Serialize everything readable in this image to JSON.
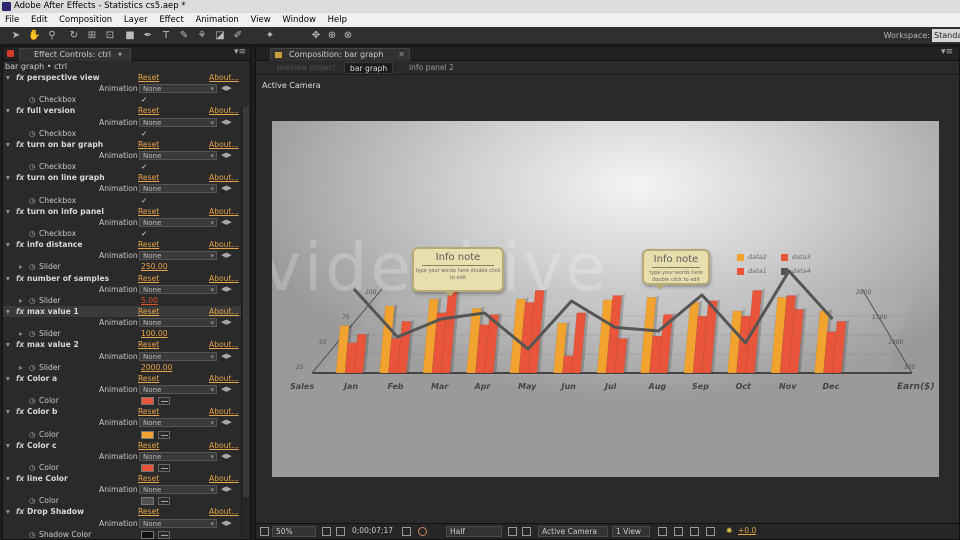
{
  "window": {
    "title": "Adobe After Effects - Statistics cs5.aep *"
  },
  "menu": [
    "File",
    "Edit",
    "Composition",
    "Layer",
    "Effect",
    "Animation",
    "View",
    "Window",
    "Help"
  ],
  "toolbar": {
    "workspace_label": "Workspace:",
    "workspace_value": "Standard"
  },
  "effect_controls": {
    "tab_label": "Effect Controls: ctrl",
    "layer_path": "bar graph • ctrl",
    "reset_label": "Reset",
    "about_label": "About...",
    "presets_label": "Animation Presets:",
    "presets_value": "None",
    "effects": [
      {
        "name": "perspective view",
        "prop": "Checkbox",
        "kind": "checkbox",
        "value": "✓"
      },
      {
        "name": "full version",
        "prop": "Checkbox",
        "kind": "checkbox",
        "value": "✓"
      },
      {
        "name": "turn on  bar graph",
        "prop": "Checkbox",
        "kind": "checkbox",
        "value": "✓"
      },
      {
        "name": "turn on  line graph",
        "prop": "Checkbox",
        "kind": "checkbox",
        "value": "✓"
      },
      {
        "name": "turn on  info panel",
        "prop": "Checkbox",
        "kind": "checkbox",
        "value": "✓"
      },
      {
        "name": "info distance",
        "prop": "Slider",
        "kind": "slider",
        "value": "250.00"
      },
      {
        "name": "number of samples",
        "prop": "Slider",
        "kind": "slider",
        "value": "5.00",
        "red": true
      },
      {
        "name": "max value 1",
        "prop": "Slider",
        "kind": "slider",
        "value": "100.00",
        "selected": true
      },
      {
        "name": "max value 2",
        "prop": "Slider",
        "kind": "slider",
        "value": "2000.00"
      },
      {
        "name": "Color a",
        "prop": "Color",
        "kind": "color",
        "value": "#e8553a"
      },
      {
        "name": "Color b",
        "prop": "Color",
        "kind": "color",
        "value": "#f2a22e"
      },
      {
        "name": "Color c",
        "prop": "Color",
        "kind": "color",
        "value": "#e8553a"
      },
      {
        "name": "line Color",
        "prop": "Color",
        "kind": "color",
        "value": "#505050"
      },
      {
        "name": "Drop Shadow",
        "prop": "Shadow Color",
        "kind": "color",
        "value": "#111111"
      }
    ]
  },
  "composition": {
    "tab_label": "Composition: bar graph",
    "breadcrumbs": [
      "preview project",
      "bar graph",
      "info panel  2"
    ],
    "camera_label": "Active Camera",
    "watermark": "videohive"
  },
  "chart_data": {
    "type": "bar",
    "categories": [
      "Jan",
      "Feb",
      "Mar",
      "Apr",
      "May",
      "Jun",
      "Jul",
      "Aug",
      "Sep",
      "Oct",
      "Nov",
      "Dec"
    ],
    "xlabel": "Sales",
    "x2label": "Earn($)",
    "left_axis_ticks": [
      "25",
      "50",
      "75",
      "100"
    ],
    "right_axis_ticks": [
      "500",
      "1000",
      "1500",
      "2000"
    ],
    "ylim": [
      0,
      100
    ],
    "series": [
      {
        "name": "data1",
        "color": "#e8553a",
        "values": [
          35,
          40,
          70,
          56,
          82,
          20,
          90,
          43,
          66,
          66,
          90,
          48
        ]
      },
      {
        "name": "data2",
        "color": "#f2a22e",
        "values": [
          55,
          78,
          86,
          75,
          86,
          58,
          85,
          88,
          82,
          72,
          88,
          72
        ]
      },
      {
        "name": "data3",
        "color": "#e8553a",
        "values": [
          45,
          60,
          95,
          68,
          96,
          70,
          40,
          68,
          84,
          96,
          74,
          60
        ]
      },
      {
        "name": "data4",
        "color": "#555555",
        "line": true,
        "values": [
          1600,
          1200,
          1350,
          1400,
          1100,
          1500,
          1280,
          1250,
          1550,
          1150,
          1750,
          1350
        ]
      }
    ],
    "notes": [
      {
        "title": "Info note",
        "text": "type your words here double click to edit"
      },
      {
        "title": "Info note",
        "text": "type your words here double click to edit"
      }
    ]
  },
  "viewer_bar": {
    "zoom": "50%",
    "timecode": "0;00;07;17",
    "resolution": "Half",
    "camera": "Active Camera",
    "views": "1 View",
    "exposure": "+0.0"
  }
}
